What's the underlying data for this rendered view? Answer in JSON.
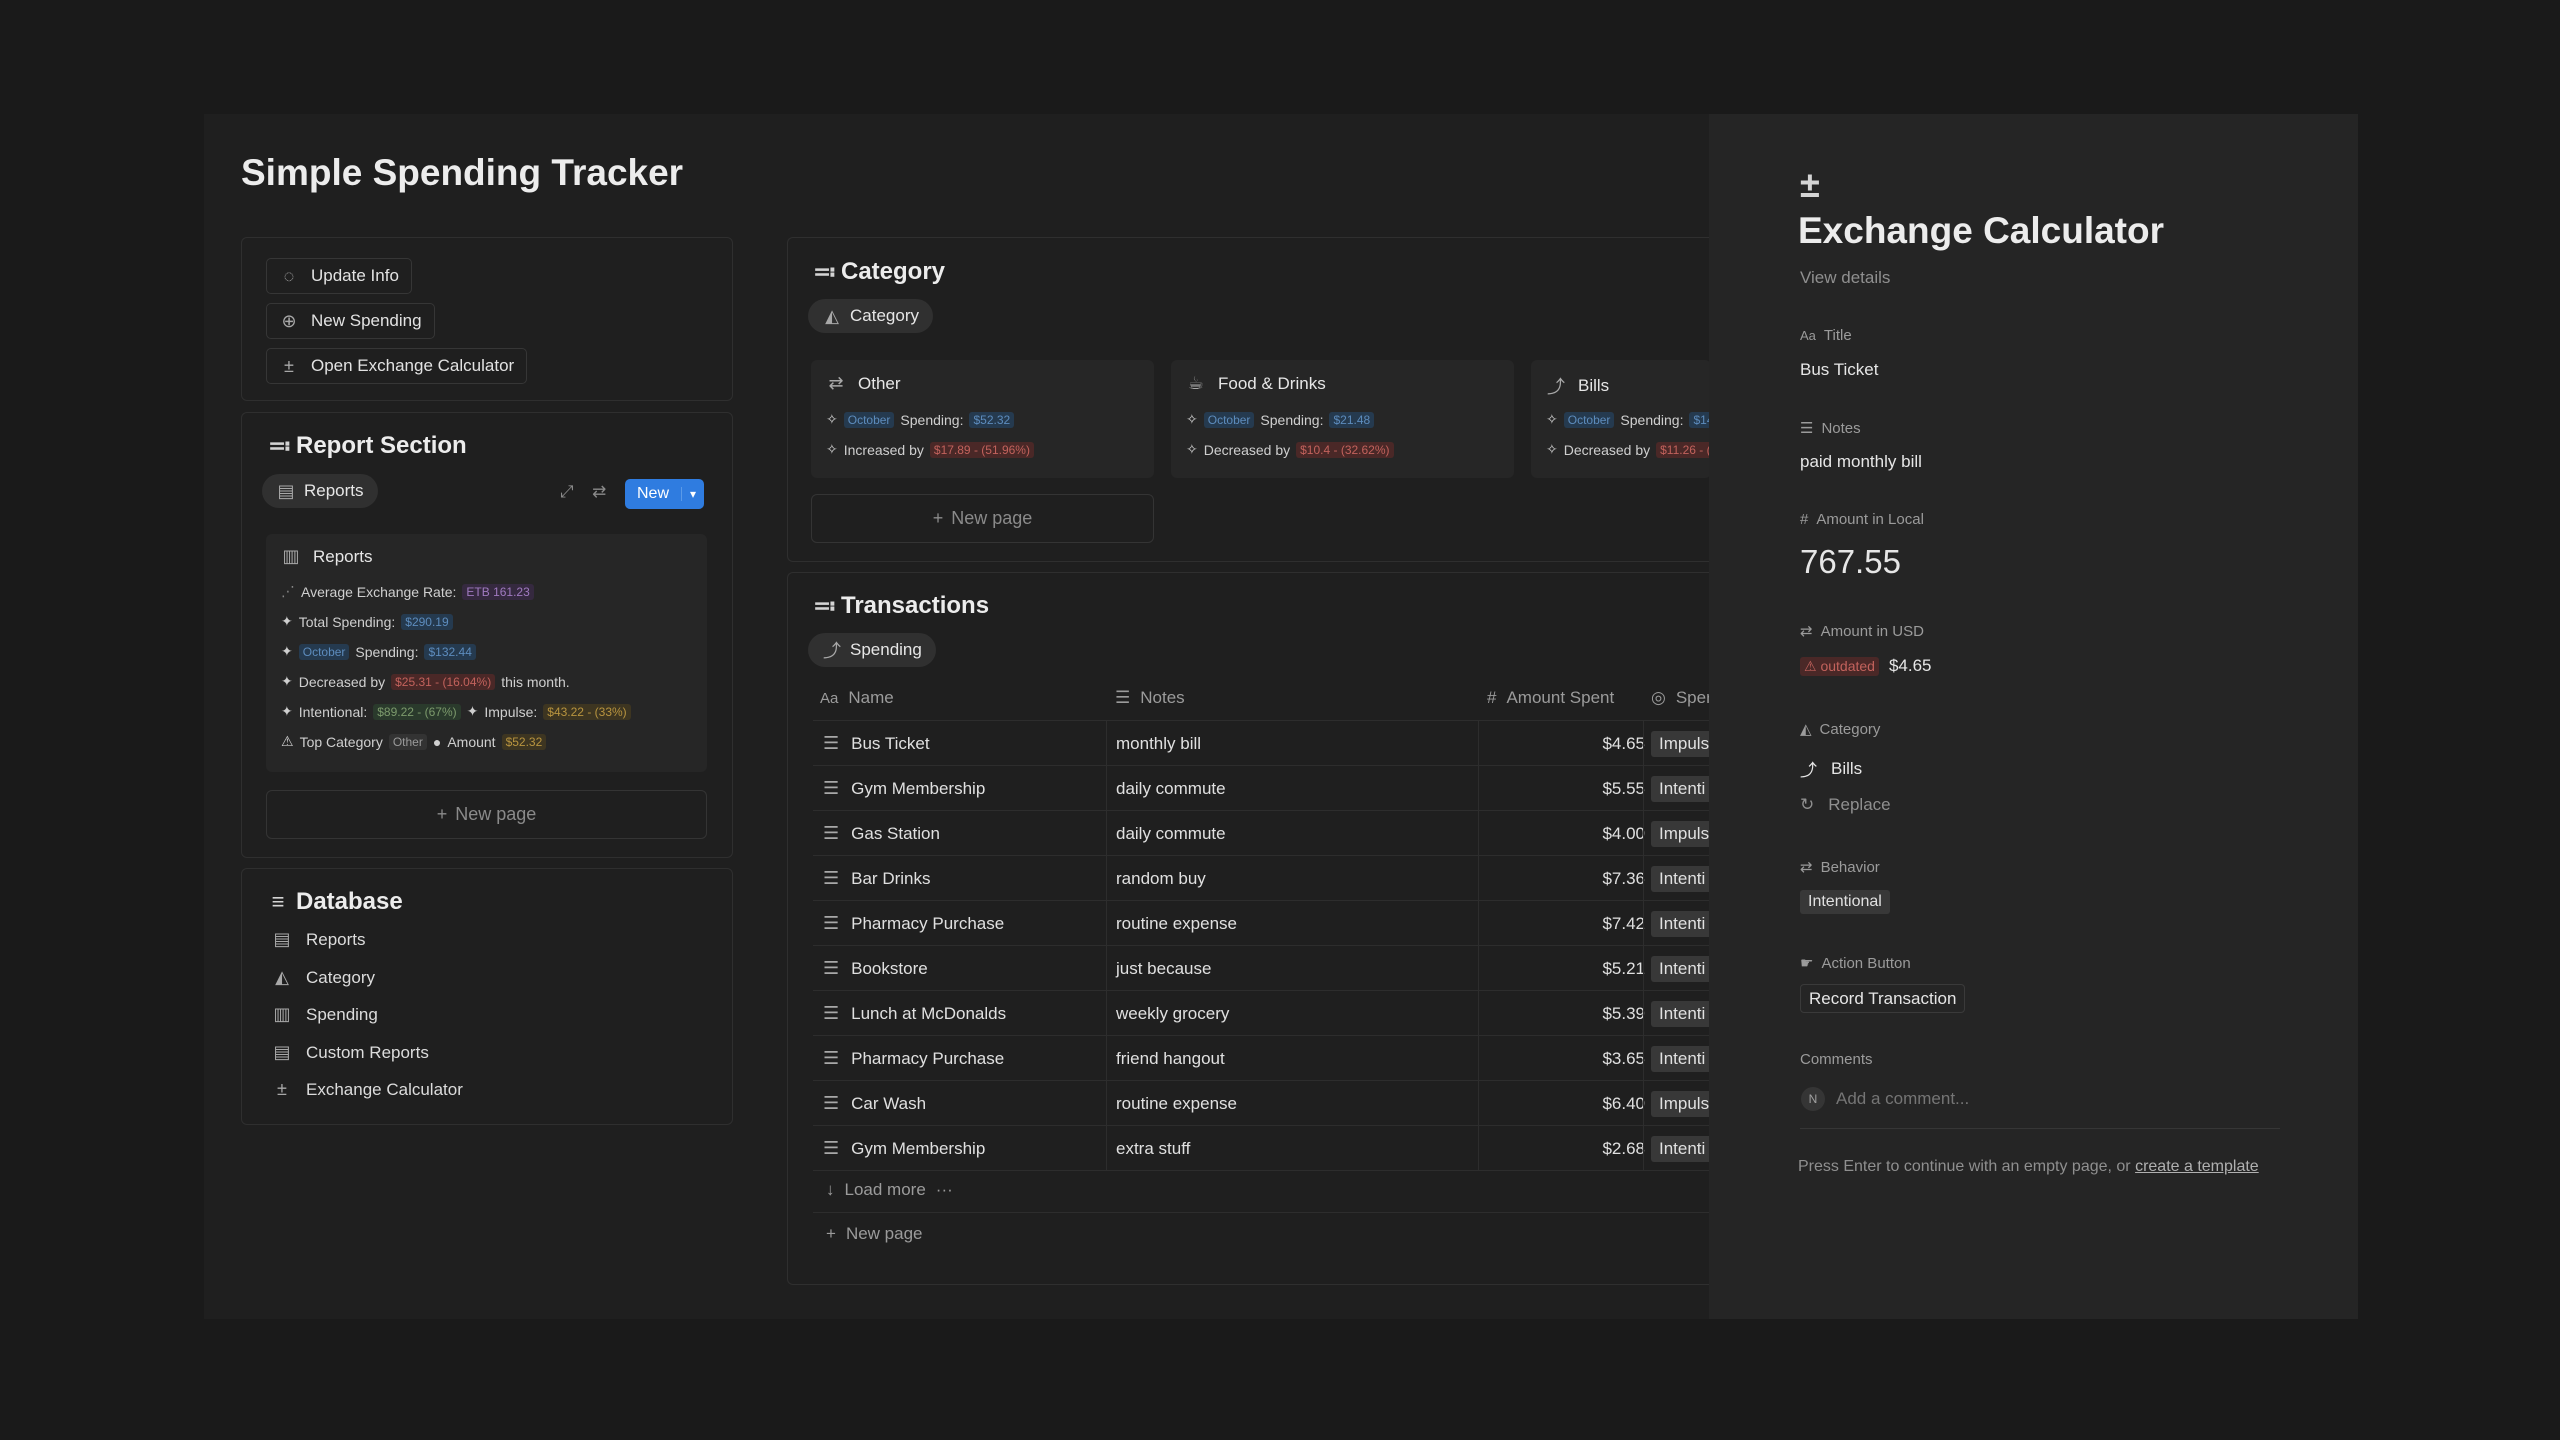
{
  "page": {
    "title": "Simple Spending Tracker"
  },
  "toolbar": {
    "update_info": "Update Info",
    "new_spending": "New Spending",
    "open_exchange": "Open Exchange Calculator"
  },
  "report_section": {
    "title": "Report Section",
    "view_tab": "Reports",
    "new_label": "New",
    "card": {
      "title": "Reports",
      "avg_rate_label": "Average Exchange Rate:",
      "avg_rate_value": "ETB 161.23",
      "total_label": "Total Spending:",
      "total_value": "$290.19",
      "month_tag": "October",
      "spending_label": "Spending:",
      "spending_value": "$132.44",
      "decreased_label": "Decreased by",
      "decreased_value": "$25.31 - (16.04%)",
      "decreased_suffix": "this month.",
      "intentional_label": "Intentional:",
      "intentional_value": "$89.22 - (67%)",
      "impulse_label": "Impulse:",
      "impulse_value": "$43.22 - (33%)",
      "top_category_label": "Top Category",
      "top_category_value": "Other",
      "amount_label": "Amount",
      "amount_value": "$52.32"
    },
    "new_page": "New page"
  },
  "database": {
    "title": "Database",
    "items": [
      {
        "label": "Reports",
        "icon": "doc-icon"
      },
      {
        "label": "Category",
        "icon": "shapes-icon"
      },
      {
        "label": "Spending",
        "icon": "bar-chart-icon"
      },
      {
        "label": "Custom Reports",
        "icon": "doc-icon"
      },
      {
        "label": "Exchange Calculator",
        "icon": "calculator-icon"
      }
    ]
  },
  "category": {
    "title": "Category",
    "view_tab": "Category",
    "cards": [
      {
        "name": "Other",
        "month": "October",
        "spending_label": "Spending:",
        "spending": "$52.32",
        "change_label": "Increased by",
        "change": "$17.89 - (51.96%)"
      },
      {
        "name": "Food & Drinks",
        "month": "October",
        "spending_label": "Spending:",
        "spending": "$21.48",
        "change_label": "Decreased by",
        "change": "$10.4 - (32.62%)"
      },
      {
        "name": "Bills",
        "month": "October",
        "spending_label": "Spending:",
        "spending": "$14",
        "change_label": "Decreased by",
        "change": "$11.26 - ("
      }
    ],
    "new_page": "New page"
  },
  "transactions": {
    "title": "Transactions",
    "view_tab": "Spending",
    "columns": {
      "name": "Name",
      "notes": "Notes",
      "amount": "Amount Spent",
      "behavior": "Sper"
    },
    "rows": [
      {
        "name": "Bus Ticket",
        "notes": "monthly bill",
        "amount": "$4.65",
        "behavior": "Impuls"
      },
      {
        "name": "Gym Membership",
        "notes": "daily commute",
        "amount": "$5.55",
        "behavior": "Intenti"
      },
      {
        "name": "Gas Station",
        "notes": "daily commute",
        "amount": "$4.00",
        "behavior": "Impuls"
      },
      {
        "name": "Bar Drinks",
        "notes": "random buy",
        "amount": "$7.36",
        "behavior": "Intenti"
      },
      {
        "name": "Pharmacy Purchase",
        "notes": "routine expense",
        "amount": "$7.42",
        "behavior": "Intenti"
      },
      {
        "name": "Bookstore",
        "notes": "just because",
        "amount": "$5.21",
        "behavior": "Intenti"
      },
      {
        "name": "Lunch at McDonalds",
        "notes": "weekly grocery",
        "amount": "$5.39",
        "behavior": "Intenti"
      },
      {
        "name": "Pharmacy Purchase",
        "notes": "friend hangout",
        "amount": "$3.65",
        "behavior": "Intenti"
      },
      {
        "name": "Car Wash",
        "notes": "routine expense",
        "amount": "$6.40",
        "behavior": "Impuls"
      },
      {
        "name": "Gym Membership",
        "notes": "extra stuff",
        "amount": "$2.68",
        "behavior": "Intenti"
      }
    ],
    "load_more": "Load more",
    "new_page": "New page"
  },
  "panel": {
    "title": "Exchange Calculator",
    "view_details": "View details",
    "title_label": "Title",
    "title_value": "Bus Ticket",
    "notes_label": "Notes",
    "notes_value": "paid monthly bill",
    "local_label": "Amount in Local",
    "local_value": "767.55",
    "usd_label": "Amount in USD",
    "usd_status": "outdated",
    "usd_value": "$4.65",
    "category_label": "Category",
    "category_value": "Bills",
    "replace_label": "Replace",
    "behavior_label": "Behavior",
    "behavior_value": "Intentional",
    "action_label": "Action Button",
    "action_value": "Record Transaction",
    "comments_label": "Comments",
    "comment_avatar": "N",
    "comment_placeholder": "Add a comment...",
    "footer_text": "Press Enter to continue with an empty page, or",
    "footer_link": "create a template"
  }
}
